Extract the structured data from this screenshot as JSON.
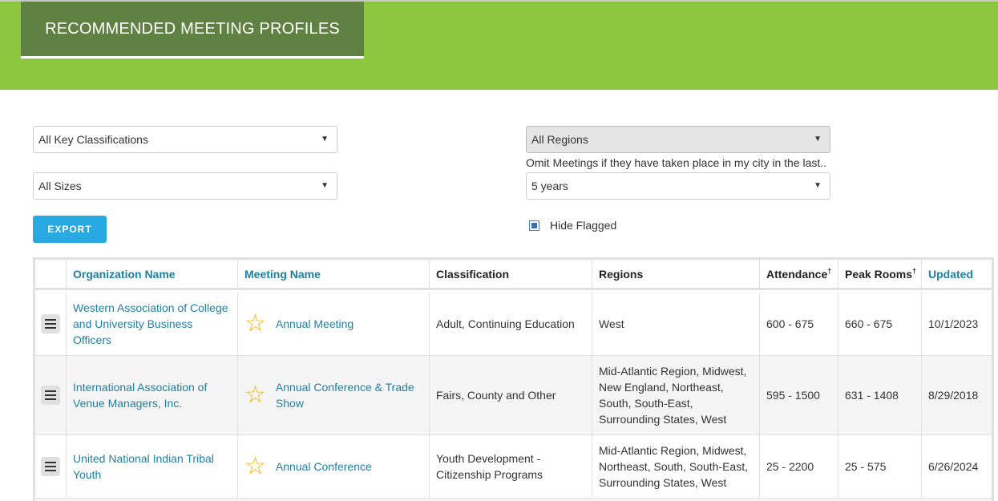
{
  "header": {
    "title": "RECOMMENDED MEETING PROFILES"
  },
  "filters": {
    "key_classifications": "All Key Classifications",
    "sizes": "All Sizes",
    "regions": "All Regions",
    "omit_label": "Omit Meetings if they have taken place in my city in the last..",
    "omit_value": "5 years",
    "export_label": "EXPORT",
    "hide_flagged_label": "Hide Flagged",
    "hide_flagged_checked": true
  },
  "table": {
    "columns": {
      "organization": "Organization Name",
      "meeting": "Meeting Name",
      "classification": "Classification",
      "regions": "Regions",
      "attendance": "Attendance",
      "attendance_mark": "†",
      "peak_rooms": "Peak Rooms",
      "peak_rooms_mark": "†",
      "updated": "Updated"
    },
    "rows": [
      {
        "organization": "Western Association of College and University Business Officers",
        "meeting": "Annual Meeting",
        "classification": "Adult, Continuing Education",
        "regions": "West",
        "attendance": "600 - 675",
        "peak_rooms": "660 - 675",
        "updated": "10/1/2023"
      },
      {
        "organization": "International Association of Venue Managers, Inc.",
        "meeting": "Annual Conference & Trade Show",
        "classification": "Fairs, County and Other",
        "regions": "Mid-Atlantic Region, Midwest, New England, Northeast, South, South-East, Surrounding States, West",
        "attendance": "595 - 1500",
        "peak_rooms": "631 - 1408",
        "updated": "8/29/2018"
      },
      {
        "organization": "United National Indian Tribal Youth",
        "meeting": "Annual Conference",
        "classification": "Youth Development - Citizenship Programs",
        "regions": "Mid-Atlantic Region, Midwest, Northeast, South, South-East, Surrounding States, West",
        "attendance": "25 - 2200",
        "peak_rooms": "25 - 575",
        "updated": "6/26/2024"
      }
    ]
  },
  "icons": {
    "menu": "hamburger-menu-icon",
    "favorite": "star-outline-icon",
    "dropdown": "caret-down-icon"
  },
  "colors": {
    "banner": "#8dc63f",
    "title_box": "#5f8141",
    "link": "#1f7fa0",
    "export": "#29a9e1",
    "star": "#f4b400"
  }
}
